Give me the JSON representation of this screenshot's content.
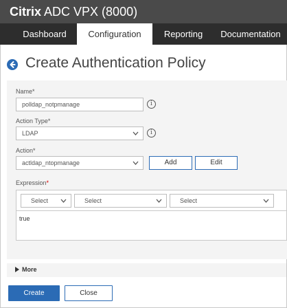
{
  "app": {
    "brand_bold": "Citrix",
    "brand_rest": " ADC VPX (8000)"
  },
  "tabs": [
    {
      "label": "Dashboard",
      "active": false
    },
    {
      "label": "Configuration",
      "active": true
    },
    {
      "label": "Reporting",
      "active": false
    },
    {
      "label": "Documentation",
      "active": false
    }
  ],
  "page": {
    "title": "Create Authentication Policy"
  },
  "form": {
    "name": {
      "label": "Name",
      "required_mark": "*",
      "value": "polldap_notpmanage"
    },
    "action_type": {
      "label": "Action Type",
      "required_mark": "*",
      "value": "LDAP"
    },
    "action": {
      "label": "Action",
      "required_mark": "*",
      "value": "actldap_ntopmanage",
      "add_label": "Add",
      "edit_label": "Edit"
    },
    "expression": {
      "label": "Expression",
      "required_mark": "*",
      "selects": [
        "Select",
        "Select",
        "Select"
      ],
      "value": "true"
    },
    "info_glyph": "i"
  },
  "more": {
    "label": "More"
  },
  "footer": {
    "create_label": "Create",
    "close_label": "Close"
  },
  "colors": {
    "accent": "#2b6bb5",
    "appbar": "#4a4a4a",
    "tabbar": "#2d2d2d",
    "panel": "#f4f4f4",
    "required": "#dd0000"
  },
  "icons": {
    "back": "arrow-left-circle-icon",
    "info": "info-circle-icon",
    "dropdown": "chevron-down-icon",
    "more": "triangle-right-icon"
  }
}
